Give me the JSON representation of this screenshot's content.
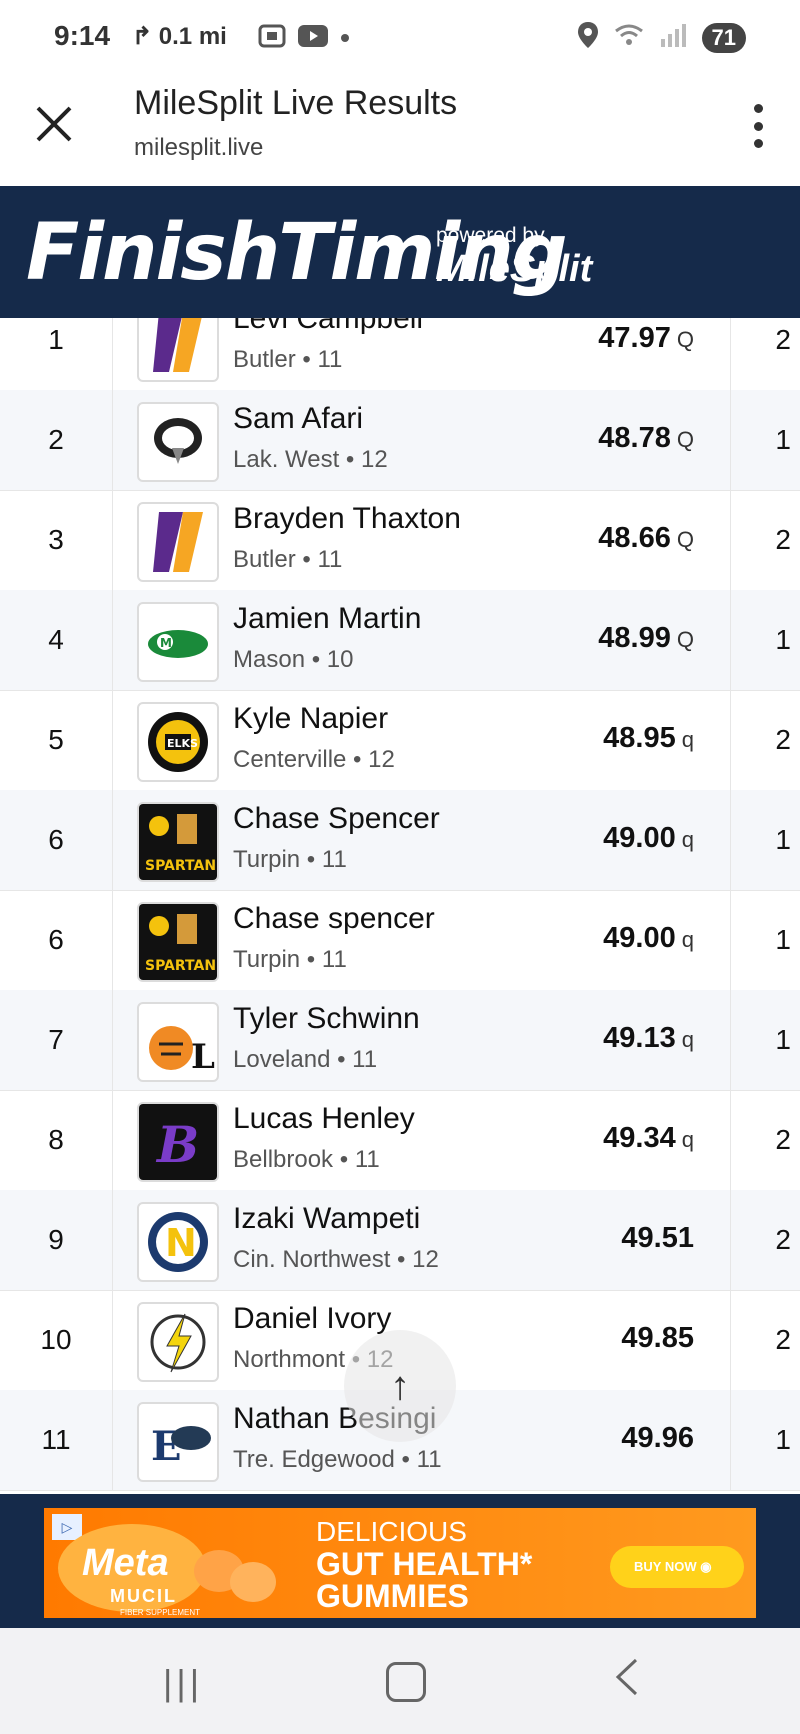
{
  "status_bar": {
    "time": "9:14",
    "nav_distance": "0.1 mi",
    "battery": "71"
  },
  "appbar": {
    "title": "MileSplit Live Results",
    "url": "milesplit.live"
  },
  "banner": {
    "logo_text": "FinishTiming",
    "powered_by": "powered by",
    "partner": "MileSplit"
  },
  "results": [
    {
      "place": "1",
      "name": "Levi Campbell",
      "team": "Butler",
      "grade": "11",
      "mark": "47.97",
      "qual": "Q",
      "heat": "2",
      "logo": "butler-logo-icon"
    },
    {
      "place": "2",
      "name": "Sam Afari",
      "team": "Lak. West",
      "grade": "12",
      "mark": "48.78",
      "qual": "Q",
      "heat": "1",
      "logo": "eagle-logo-icon"
    },
    {
      "place": "3",
      "name": "Brayden Thaxton",
      "team": "Butler",
      "grade": "11",
      "mark": "48.66",
      "qual": "Q",
      "heat": "2",
      "logo": "butler-logo-icon"
    },
    {
      "place": "4",
      "name": "Jamien Martin",
      "team": "Mason",
      "grade": "10",
      "mark": "48.99",
      "qual": "Q",
      "heat": "1",
      "logo": "mason-logo-icon"
    },
    {
      "place": "5",
      "name": "Kyle Napier",
      "team": "Centerville",
      "grade": "12",
      "mark": "48.95",
      "qual": "q",
      "heat": "2",
      "logo": "elks-logo-icon"
    },
    {
      "place": "6",
      "name": "Chase Spencer",
      "team": "Turpin",
      "grade": "11",
      "mark": "49.00",
      "qual": "q",
      "heat": "1",
      "logo": "spartans-logo-icon"
    },
    {
      "place": "6",
      "name": "Chase spencer",
      "team": "Turpin",
      "grade": "11",
      "mark": "49.00",
      "qual": "q",
      "heat": "1",
      "logo": "spartans-logo-icon"
    },
    {
      "place": "7",
      "name": "Tyler Schwinn",
      "team": "Loveland",
      "grade": "11",
      "mark": "49.13",
      "qual": "q",
      "heat": "1",
      "logo": "tiger-logo-icon"
    },
    {
      "place": "8",
      "name": "Lucas Henley",
      "team": "Bellbrook",
      "grade": "11",
      "mark": "49.34",
      "qual": "q",
      "heat": "2",
      "logo": "bellbrook-logo-icon"
    },
    {
      "place": "9",
      "name": "Izaki Wampeti",
      "team": "Cin. Northwest",
      "grade": "12",
      "mark": "49.51",
      "qual": "",
      "heat": "2",
      "logo": "northwest-logo-icon"
    },
    {
      "place": "10",
      "name": "Daniel Ivory",
      "team": "Northmont",
      "grade": "12",
      "mark": "49.85",
      "qual": "",
      "heat": "2",
      "logo": "lightning-logo-icon"
    },
    {
      "place": "11",
      "name": "Nathan Besingi",
      "team": "Tre. Edgewood",
      "grade": "11",
      "mark": "49.96",
      "qual": "",
      "heat": "1",
      "logo": "edgewood-logo-icon"
    }
  ],
  "ad": {
    "brand": "Meta",
    "sub_brand": "MUCIL",
    "fiber": "FIBER SUPPLEMENT",
    "line1": "DELICIOUS",
    "line2": "GUT HEALTH*",
    "line3": "GUMMIES",
    "cta": "BUY NOW"
  },
  "scroll_top": "↑"
}
